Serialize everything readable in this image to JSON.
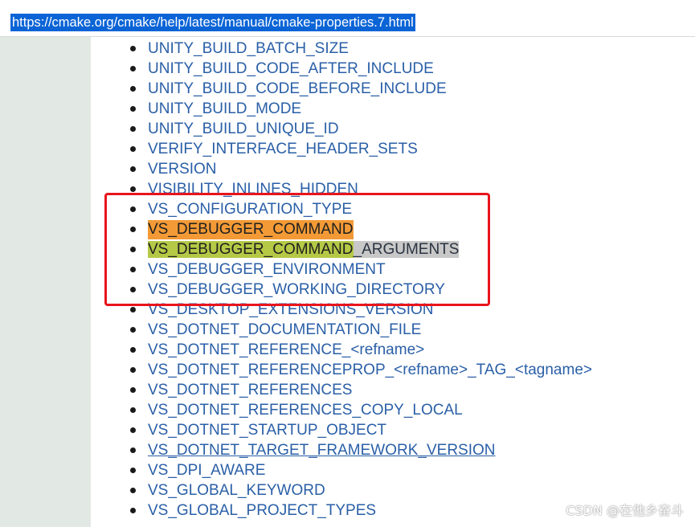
{
  "url_bar": {
    "url": "https://cmake.org/cmake/help/latest/manual/cmake-properties.7.html"
  },
  "properties": [
    {
      "label": "UNITY_BUILD_BATCH_SIZE"
    },
    {
      "label": "UNITY_BUILD_CODE_AFTER_INCLUDE"
    },
    {
      "label": "UNITY_BUILD_CODE_BEFORE_INCLUDE"
    },
    {
      "label": "UNITY_BUILD_MODE"
    },
    {
      "label": "UNITY_BUILD_UNIQUE_ID"
    },
    {
      "label": "VERIFY_INTERFACE_HEADER_SETS"
    },
    {
      "label": "VERSION"
    },
    {
      "label": "VISIBILITY_INLINES_HIDDEN"
    },
    {
      "label": "VS_CONFIGURATION_TYPE"
    },
    {
      "label": "VS_DEBUGGER_COMMAND",
      "highlight": "orange"
    },
    {
      "label_main": "VS_DEBUGGER_COMMAND",
      "label_suffix": "_ARGUMENTS",
      "highlight": "green-gray"
    },
    {
      "label": "VS_DEBUGGER_ENVIRONMENT"
    },
    {
      "label": "VS_DEBUGGER_WORKING_DIRECTORY"
    },
    {
      "label": "VS_DESKTOP_EXTENSIONS_VERSION"
    },
    {
      "label": "VS_DOTNET_DOCUMENTATION_FILE"
    },
    {
      "label": "VS_DOTNET_REFERENCE_<refname>"
    },
    {
      "label": "VS_DOTNET_REFERENCEPROP_<refname>_TAG_<tagname>"
    },
    {
      "label": "VS_DOTNET_REFERENCES"
    },
    {
      "label": "VS_DOTNET_REFERENCES_COPY_LOCAL"
    },
    {
      "label": "VS_DOTNET_STARTUP_OBJECT"
    },
    {
      "label": "VS_DOTNET_TARGET_FRAMEWORK_VERSION",
      "underlined": true
    },
    {
      "label": "VS_DPI_AWARE"
    },
    {
      "label": "VS_GLOBAL_KEYWORD"
    },
    {
      "label": "VS_GLOBAL_PROJECT_TYPES"
    }
  ],
  "annotation": {
    "color": "#e8141c"
  },
  "watermark": {
    "text": "CSDN @在他乡奋斗"
  },
  "colors": {
    "link": "#2a5fa7",
    "sidebar": "#e2e9e4",
    "url_selection": "#0a64d6",
    "highlight_orange": "#f39a36",
    "highlight_green": "#b5c946",
    "highlight_gray": "#c8c8c8"
  }
}
